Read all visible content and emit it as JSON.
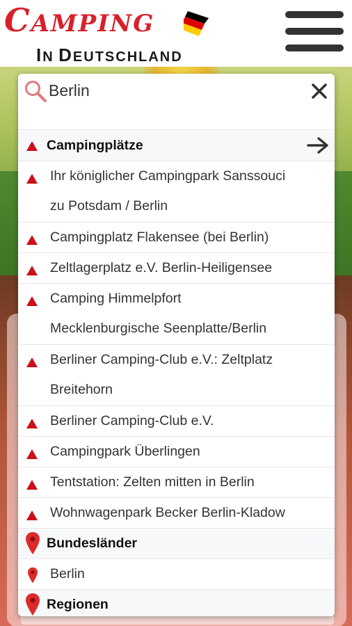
{
  "header": {
    "logo_title_first": "C",
    "logo_title_rest": "AMPING",
    "logo_sub_first_1": "I",
    "logo_sub_rest_1": "N",
    "logo_sub_first_2": "D",
    "logo_sub_rest_2": "EUTSCHLAND",
    "flag_colors": [
      "#000000",
      "#dd0000",
      "#ffcc00"
    ],
    "menu_icon": "hamburger-menu-icon"
  },
  "search": {
    "value": "Berlin",
    "icon": "search-icon",
    "clear_icon": "close-icon"
  },
  "accent_color": "#cc0f1a",
  "results": {
    "campsites_header": "Campingplätze",
    "campsites_arrow_icon": "arrow-right-icon",
    "campsites": [
      {
        "line1": "Ihr königlicher Campingpark Sanssouci",
        "line2": "zu Potsdam / Berlin"
      },
      {
        "line1": "Campingplatz Flakensee (bei Berlin)",
        "line2": ""
      },
      {
        "line1": "Zeltlagerplatz e.V. Berlin-Heiligensee",
        "line2": ""
      },
      {
        "line1": "Camping Himmelpfort",
        "line2": "Mecklenburgische Seenplatte/Berlin"
      },
      {
        "line1": "Berliner Camping-Club e.V.: Zeltplatz",
        "line2": "Breitehorn"
      },
      {
        "line1": "Berliner Camping-Club e.V.",
        "line2": ""
      },
      {
        "line1": "Campingpark Überlingen",
        "line2": ""
      },
      {
        "line1": "Tentstation: Zelten mitten in Berlin",
        "line2": ""
      },
      {
        "line1": "Wohnwagenpark Becker Berlin-Kladow",
        "line2": ""
      }
    ],
    "states_header": "Bundesländer",
    "states": [
      "Berlin"
    ],
    "regions_header": "Regionen"
  }
}
